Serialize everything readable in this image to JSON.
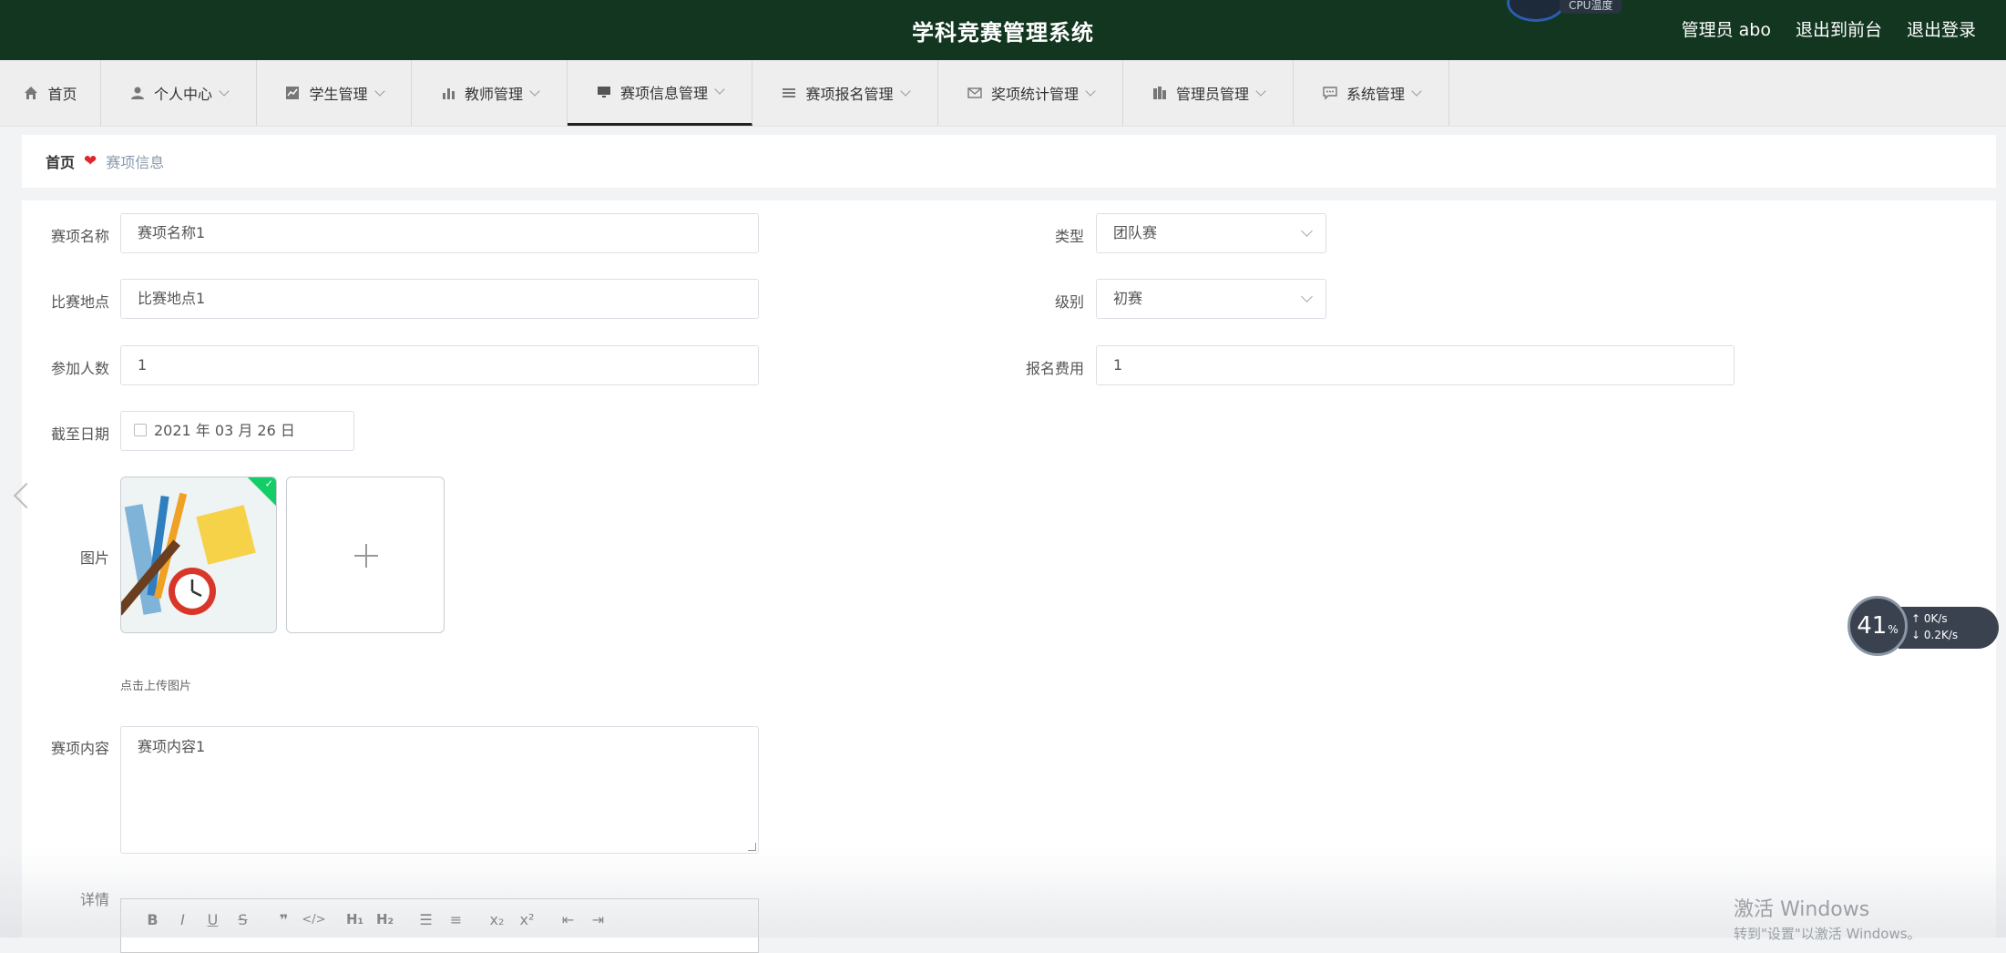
{
  "header": {
    "title": "学科竞赛管理系统",
    "user": "管理员 abo",
    "to_front": "退出到前台",
    "logout": "退出登录",
    "cpu_label": "CPU温度"
  },
  "nav": {
    "items": [
      {
        "label": "首页",
        "icon": "home-icon"
      },
      {
        "label": "个人中心",
        "icon": "user-icon"
      },
      {
        "label": "学生管理",
        "icon": "trend-icon"
      },
      {
        "label": "教师管理",
        "icon": "bar-chart-icon"
      },
      {
        "label": "赛项信息管理",
        "icon": "monitor-icon",
        "active": true
      },
      {
        "label": "赛项报名管理",
        "icon": "list-icon"
      },
      {
        "label": "奖项统计管理",
        "icon": "mail-icon"
      },
      {
        "label": "管理员管理",
        "icon": "building-icon"
      },
      {
        "label": "系统管理",
        "icon": "chat-icon"
      }
    ]
  },
  "breadcrumb": {
    "home": "首页",
    "current": "赛项信息"
  },
  "form": {
    "name_label": "赛项名称",
    "name_value": "赛项名称1",
    "type_label": "类型",
    "type_value": "团队赛",
    "location_label": "比赛地点",
    "location_value": "比赛地点1",
    "level_label": "级别",
    "level_value": "初赛",
    "count_label": "参加人数",
    "count_value": "1",
    "fee_label": "报名费用",
    "fee_value": "1",
    "deadline_label": "截至日期",
    "deadline_value": "2021 年 03 月 26 日",
    "image_label": "图片",
    "upload_hint": "点击上传图片",
    "content_label": "赛项内容",
    "content_value": "赛项内容1",
    "detail_label": "详情"
  },
  "widgets": {
    "net_percent": "41",
    "net_unit": "%",
    "net_up": "0K/s",
    "net_down": "0.2K/s",
    "activation_title": "激活 Windows",
    "activation_sub": "转到\"设置\"以激活 Windows。"
  }
}
